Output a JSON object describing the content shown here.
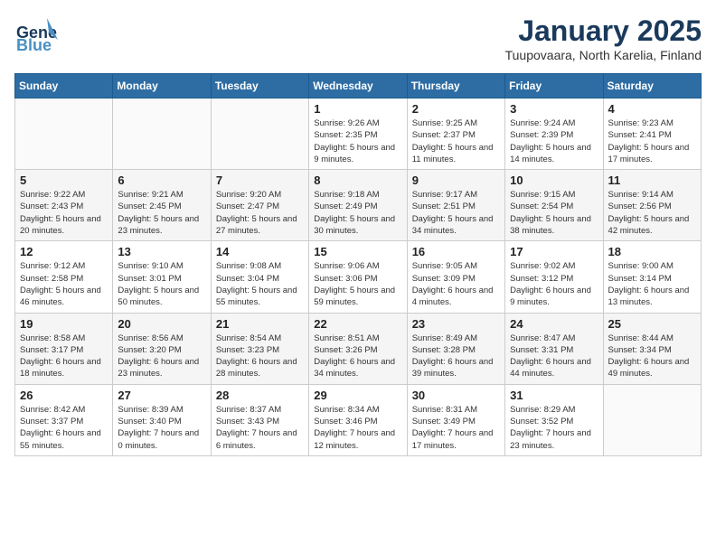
{
  "header": {
    "logo_line1": "General",
    "logo_line2": "Blue",
    "title": "January 2025",
    "subtitle": "Tuupovaara, North Karelia, Finland"
  },
  "weekdays": [
    "Sunday",
    "Monday",
    "Tuesday",
    "Wednesday",
    "Thursday",
    "Friday",
    "Saturday"
  ],
  "weeks": [
    [
      {
        "day": "",
        "info": ""
      },
      {
        "day": "",
        "info": ""
      },
      {
        "day": "",
        "info": ""
      },
      {
        "day": "1",
        "info": "Sunrise: 9:26 AM\nSunset: 2:35 PM\nDaylight: 5 hours\nand 9 minutes."
      },
      {
        "day": "2",
        "info": "Sunrise: 9:25 AM\nSunset: 2:37 PM\nDaylight: 5 hours\nand 11 minutes."
      },
      {
        "day": "3",
        "info": "Sunrise: 9:24 AM\nSunset: 2:39 PM\nDaylight: 5 hours\nand 14 minutes."
      },
      {
        "day": "4",
        "info": "Sunrise: 9:23 AM\nSunset: 2:41 PM\nDaylight: 5 hours\nand 17 minutes."
      }
    ],
    [
      {
        "day": "5",
        "info": "Sunrise: 9:22 AM\nSunset: 2:43 PM\nDaylight: 5 hours\nand 20 minutes."
      },
      {
        "day": "6",
        "info": "Sunrise: 9:21 AM\nSunset: 2:45 PM\nDaylight: 5 hours\nand 23 minutes."
      },
      {
        "day": "7",
        "info": "Sunrise: 9:20 AM\nSunset: 2:47 PM\nDaylight: 5 hours\nand 27 minutes."
      },
      {
        "day": "8",
        "info": "Sunrise: 9:18 AM\nSunset: 2:49 PM\nDaylight: 5 hours\nand 30 minutes."
      },
      {
        "day": "9",
        "info": "Sunrise: 9:17 AM\nSunset: 2:51 PM\nDaylight: 5 hours\nand 34 minutes."
      },
      {
        "day": "10",
        "info": "Sunrise: 9:15 AM\nSunset: 2:54 PM\nDaylight: 5 hours\nand 38 minutes."
      },
      {
        "day": "11",
        "info": "Sunrise: 9:14 AM\nSunset: 2:56 PM\nDaylight: 5 hours\nand 42 minutes."
      }
    ],
    [
      {
        "day": "12",
        "info": "Sunrise: 9:12 AM\nSunset: 2:58 PM\nDaylight: 5 hours\nand 46 minutes."
      },
      {
        "day": "13",
        "info": "Sunrise: 9:10 AM\nSunset: 3:01 PM\nDaylight: 5 hours\nand 50 minutes."
      },
      {
        "day": "14",
        "info": "Sunrise: 9:08 AM\nSunset: 3:04 PM\nDaylight: 5 hours\nand 55 minutes."
      },
      {
        "day": "15",
        "info": "Sunrise: 9:06 AM\nSunset: 3:06 PM\nDaylight: 5 hours\nand 59 minutes."
      },
      {
        "day": "16",
        "info": "Sunrise: 9:05 AM\nSunset: 3:09 PM\nDaylight: 6 hours\nand 4 minutes."
      },
      {
        "day": "17",
        "info": "Sunrise: 9:02 AM\nSunset: 3:12 PM\nDaylight: 6 hours\nand 9 minutes."
      },
      {
        "day": "18",
        "info": "Sunrise: 9:00 AM\nSunset: 3:14 PM\nDaylight: 6 hours\nand 13 minutes."
      }
    ],
    [
      {
        "day": "19",
        "info": "Sunrise: 8:58 AM\nSunset: 3:17 PM\nDaylight: 6 hours\nand 18 minutes."
      },
      {
        "day": "20",
        "info": "Sunrise: 8:56 AM\nSunset: 3:20 PM\nDaylight: 6 hours\nand 23 minutes."
      },
      {
        "day": "21",
        "info": "Sunrise: 8:54 AM\nSunset: 3:23 PM\nDaylight: 6 hours\nand 28 minutes."
      },
      {
        "day": "22",
        "info": "Sunrise: 8:51 AM\nSunset: 3:26 PM\nDaylight: 6 hours\nand 34 minutes."
      },
      {
        "day": "23",
        "info": "Sunrise: 8:49 AM\nSunset: 3:28 PM\nDaylight: 6 hours\nand 39 minutes."
      },
      {
        "day": "24",
        "info": "Sunrise: 8:47 AM\nSunset: 3:31 PM\nDaylight: 6 hours\nand 44 minutes."
      },
      {
        "day": "25",
        "info": "Sunrise: 8:44 AM\nSunset: 3:34 PM\nDaylight: 6 hours\nand 49 minutes."
      }
    ],
    [
      {
        "day": "26",
        "info": "Sunrise: 8:42 AM\nSunset: 3:37 PM\nDaylight: 6 hours\nand 55 minutes."
      },
      {
        "day": "27",
        "info": "Sunrise: 8:39 AM\nSunset: 3:40 PM\nDaylight: 7 hours\nand 0 minutes."
      },
      {
        "day": "28",
        "info": "Sunrise: 8:37 AM\nSunset: 3:43 PM\nDaylight: 7 hours\nand 6 minutes."
      },
      {
        "day": "29",
        "info": "Sunrise: 8:34 AM\nSunset: 3:46 PM\nDaylight: 7 hours\nand 12 minutes."
      },
      {
        "day": "30",
        "info": "Sunrise: 8:31 AM\nSunset: 3:49 PM\nDaylight: 7 hours\nand 17 minutes."
      },
      {
        "day": "31",
        "info": "Sunrise: 8:29 AM\nSunset: 3:52 PM\nDaylight: 7 hours\nand 23 minutes."
      },
      {
        "day": "",
        "info": ""
      }
    ]
  ]
}
